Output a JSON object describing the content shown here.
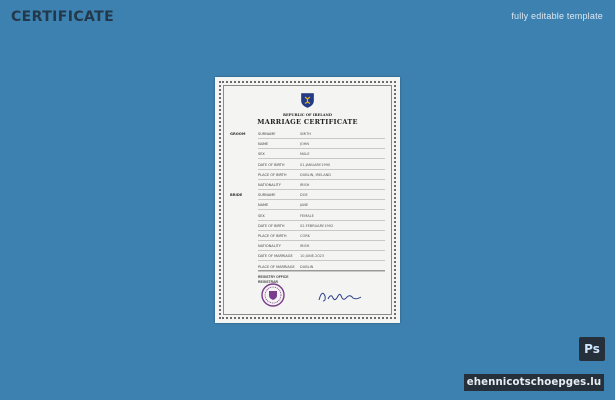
{
  "page": {
    "title": "CERTIFICATE",
    "subtitle": "fully editable template"
  },
  "certificate": {
    "line1": "REPUBLIC OF IRELAND",
    "title": "MARRIAGE CERTIFICATE",
    "side_groom": "GROOM",
    "side_bride": "BRIDE",
    "groom_rows": [
      {
        "label": "SURNAME",
        "value": "SMITH"
      },
      {
        "label": "NAME",
        "value": "JOHN"
      },
      {
        "label": "SEX",
        "value": "MALE"
      },
      {
        "label": "DATE OF BIRTH",
        "value": "01.JANUARY.1990"
      },
      {
        "label": "PLACE OF BIRTH",
        "value": "DUBLIN, IRELAND"
      },
      {
        "label": "NATIONALITY",
        "value": "IRISH"
      }
    ],
    "bride_rows": [
      {
        "label": "SURNAME",
        "value": "DOE"
      },
      {
        "label": "NAME",
        "value": "JANE"
      },
      {
        "label": "SEX",
        "value": "FEMALE"
      },
      {
        "label": "DATE OF BIRTH",
        "value": "02.FEBRUARY.1992"
      },
      {
        "label": "PLACE OF BIRTH",
        "value": "CORK"
      },
      {
        "label": "NATIONALITY",
        "value": "IRISH"
      },
      {
        "label": "DATE OF MARRIAGE",
        "value": "10.JUNE.2023"
      },
      {
        "label": "PLACE OF MARRIAGE",
        "value": "DUBLIN"
      }
    ],
    "registry_label": "REGISTRY OFFICE",
    "registry_label2": "REGISTRAR"
  },
  "badges": {
    "ps": "Ps",
    "watermark": "ehennicotschoepges.lu"
  },
  "colors": {
    "background": "#3d81b0",
    "title": "#23384a",
    "dark_badge": "#26303a",
    "seal": "#7a3c8c",
    "crest_blue": "#233a8a",
    "crest_gold": "#e3b51a"
  }
}
